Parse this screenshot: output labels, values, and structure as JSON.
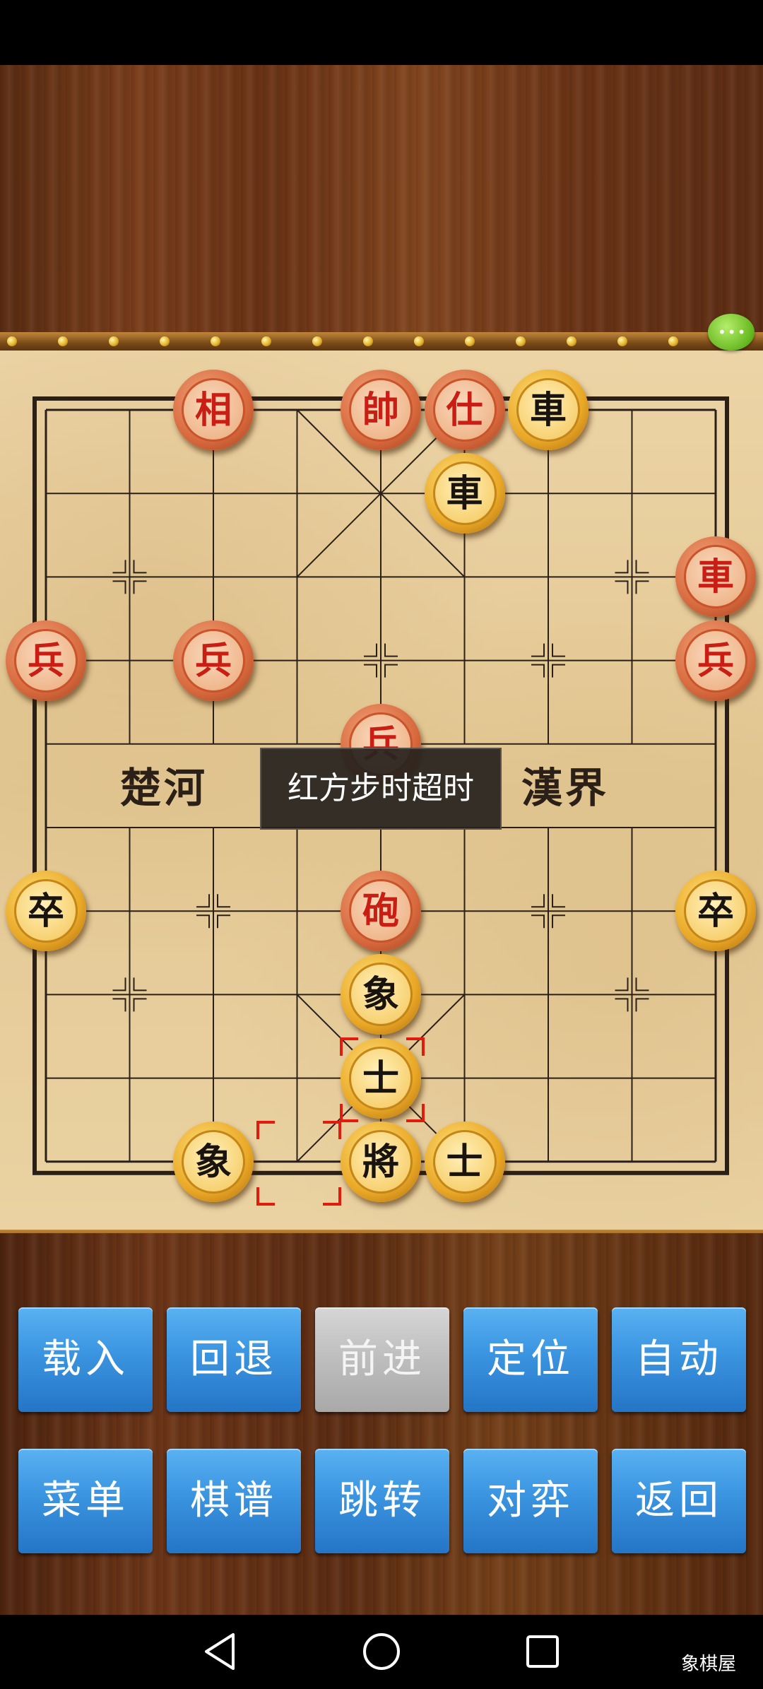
{
  "board": {
    "river_left": "楚河",
    "river_right": "漢界",
    "toast": "红方步时超时"
  },
  "pieces": [
    {
      "side": "red",
      "char": "相",
      "col": 2,
      "row": 0
    },
    {
      "side": "red",
      "char": "帥",
      "col": 4,
      "row": 0
    },
    {
      "side": "red",
      "char": "仕",
      "col": 5,
      "row": 0
    },
    {
      "side": "black",
      "char": "車",
      "col": 6,
      "row": 0
    },
    {
      "side": "black",
      "char": "車",
      "col": 5,
      "row": 1
    },
    {
      "side": "red",
      "char": "車",
      "col": 8,
      "row": 2
    },
    {
      "side": "red",
      "char": "兵",
      "col": 0,
      "row": 3
    },
    {
      "side": "red",
      "char": "兵",
      "col": 2,
      "row": 3
    },
    {
      "side": "red",
      "char": "兵",
      "col": 8,
      "row": 3
    },
    {
      "side": "red",
      "char": "兵",
      "col": 4,
      "row": 4
    },
    {
      "side": "black",
      "char": "卒",
      "col": 0,
      "row": 6
    },
    {
      "side": "red",
      "char": "砲",
      "col": 4,
      "row": 6
    },
    {
      "side": "black",
      "char": "卒",
      "col": 8,
      "row": 6
    },
    {
      "side": "black",
      "char": "象",
      "col": 4,
      "row": 7
    },
    {
      "side": "black",
      "char": "士",
      "col": 4,
      "row": 8
    },
    {
      "side": "black",
      "char": "象",
      "col": 2,
      "row": 9
    },
    {
      "side": "black",
      "char": "將",
      "col": 4,
      "row": 9
    },
    {
      "side": "black",
      "char": "士",
      "col": 5,
      "row": 9
    }
  ],
  "selection": [
    {
      "col": 4,
      "row": 8
    },
    {
      "col": 3,
      "row": 9
    }
  ],
  "buttons_row1": [
    "载入",
    "回退",
    "前进",
    "定位",
    "自动"
  ],
  "buttons_row2": [
    "菜单",
    "棋谱",
    "跳转",
    "对弈",
    "返回"
  ],
  "disabled_button": "前进",
  "watermark": "象棋屋",
  "colors": {
    "red_piece": "#c81e14",
    "black_piece": "#1a140e",
    "button": "#3d97e2"
  }
}
